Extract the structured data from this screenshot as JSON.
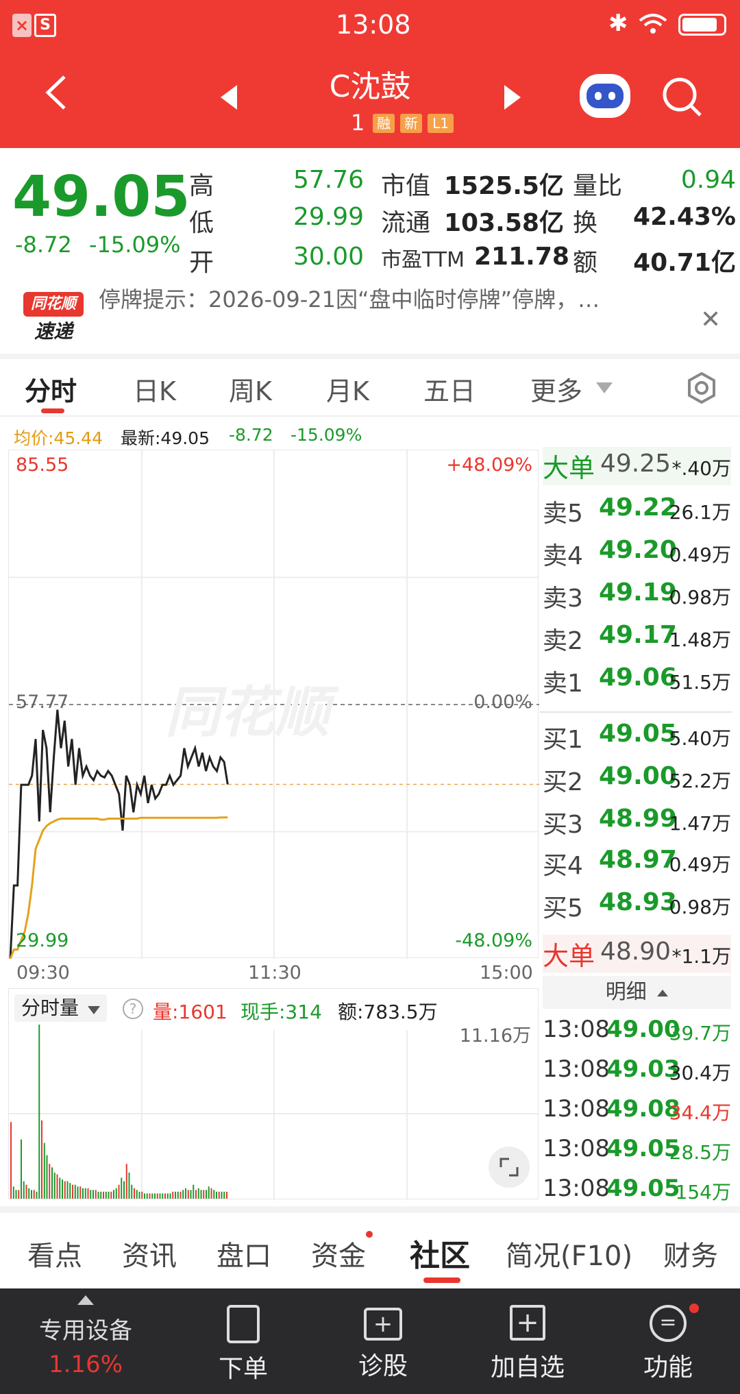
{
  "status": {
    "time": "13:08",
    "left_icons": [
      "close-badge-icon",
      "s-badge-icon"
    ],
    "right_icons": [
      "bluetooth-icon",
      "wifi-icon",
      "battery-icon"
    ]
  },
  "header": {
    "title": "C沈鼓",
    "code_suffix": "1",
    "badges": [
      "融",
      "新",
      "L1"
    ]
  },
  "quote": {
    "price": "49.05",
    "change": "-8.72",
    "pct": "-15.09%",
    "grid": [
      {
        "label": "高",
        "value": "57.76"
      },
      {
        "label": "低",
        "value": "29.99"
      },
      {
        "label": "开",
        "value": "30.00"
      },
      {
        "label": "市值",
        "value": "1525.5亿"
      },
      {
        "label": "流通",
        "value": "103.58亿"
      },
      {
        "label": "市盈TTM",
        "value": "211.78"
      },
      {
        "label": "量比",
        "value": "0.94"
      },
      {
        "label": "换",
        "value": "42.43%"
      },
      {
        "label": "额",
        "value": "40.71亿"
      }
    ]
  },
  "notice": {
    "brand_top": "同花顺",
    "brand_bottom": "速递",
    "text": "停牌提示：2026-09-21因“盘中临时停牌”停牌，…"
  },
  "tabs": [
    "分时",
    "日K",
    "周K",
    "月K",
    "五日",
    "更多"
  ],
  "info": {
    "avg": "均价:45.44",
    "latest": "最新:49.05",
    "change": "-8.72",
    "pct": "-15.09%"
  },
  "chart_data": {
    "type": "line",
    "y_top": "85.55",
    "y_mid": "57.77",
    "y_bottom": "29.99",
    "pct_top": "+48.09%",
    "pct_mid": "0.00%",
    "pct_bottom": "-48.09%",
    "x_labels": [
      "09:30",
      "11:30",
      "15:00"
    ],
    "ylim": [
      29.99,
      85.55
    ],
    "series": [
      {
        "name": "price",
        "values": [
          29.99,
          38,
          38,
          49,
          49,
          49,
          50,
          54,
          45,
          55,
          53,
          46,
          52,
          57.2,
          53,
          56,
          51,
          54,
          49,
          53,
          50,
          51,
          50,
          49.5,
          50.5,
          50,
          49.8,
          50.5,
          50,
          49,
          48,
          44,
          50,
          49,
          46,
          49,
          48,
          50,
          47,
          49,
          47.5,
          48,
          49,
          49,
          50,
          49,
          49.5,
          50,
          53,
          51,
          52,
          53,
          51,
          52.5,
          50.5,
          52,
          51,
          50.5,
          52,
          51.5,
          49.05
        ]
      },
      {
        "name": "avg",
        "values": [
          29.99,
          31,
          31,
          32,
          33,
          35,
          38,
          42,
          43,
          44,
          44.5,
          44.8,
          45,
          45.2,
          45.3,
          45.3,
          45.3,
          45.3,
          45.3,
          45.3,
          45.3,
          45.3,
          45.3,
          45.3,
          45.3,
          45.2,
          45.2,
          45.3,
          45.3,
          45.3,
          45.3,
          45.3,
          45.3,
          45.3,
          45.3,
          45.3,
          45.4,
          45.4,
          45.4,
          45.4,
          45.4,
          45.4,
          45.4,
          45.4,
          45.4,
          45.4,
          45.4,
          45.4,
          45.4,
          45.4,
          45.4,
          45.4,
          45.4,
          45.4,
          45.4,
          45.4,
          45.4,
          45.4,
          45.44,
          45.44,
          45.44
        ]
      }
    ]
  },
  "volume": {
    "selector": "分时量",
    "amount": "量:1601",
    "hand": "现手:314",
    "value": "额:783.5万",
    "max": "11.16万",
    "bars": [
      0.44,
      0.07,
      0.05,
      0.05,
      0.34,
      0.1,
      0.08,
      0.06,
      0.05,
      0.05,
      0.04,
      1.0,
      0.45,
      0.32,
      0.25,
      0.2,
      0.18,
      0.15,
      0.14,
      0.12,
      0.11,
      0.1,
      0.1,
      0.09,
      0.08,
      0.08,
      0.07,
      0.07,
      0.06,
      0.06,
      0.06,
      0.05,
      0.05,
      0.05,
      0.04,
      0.04,
      0.04,
      0.04,
      0.04,
      0.04,
      0.05,
      0.06,
      0.08,
      0.12,
      0.1,
      0.2,
      0.15,
      0.08,
      0.06,
      0.05,
      0.04,
      0.04,
      0.03,
      0.03,
      0.03,
      0.03,
      0.03,
      0.03,
      0.03,
      0.03,
      0.03,
      0.03,
      0.03,
      0.04,
      0.04,
      0.04,
      0.04,
      0.05,
      0.06,
      0.05,
      0.05,
      0.08,
      0.05,
      0.06,
      0.05,
      0.05,
      0.05,
      0.07,
      0.06,
      0.05,
      0.04,
      0.04,
      0.04,
      0.04,
      0.04
    ]
  },
  "book": {
    "big_sell": {
      "label": "大单",
      "price": "49.25",
      "vol": "*.40万"
    },
    "asks": [
      {
        "label": "卖5",
        "price": "49.22",
        "vol": "26.1万"
      },
      {
        "label": "卖4",
        "price": "49.20",
        "vol": "0.49万"
      },
      {
        "label": "卖3",
        "price": "49.19",
        "vol": "0.98万"
      },
      {
        "label": "卖2",
        "price": "49.17",
        "vol": "1.48万"
      },
      {
        "label": "卖1",
        "price": "49.06",
        "vol": "51.5万"
      }
    ],
    "bids": [
      {
        "label": "买1",
        "price": "49.05",
        "vol": "5.40万"
      },
      {
        "label": "买2",
        "price": "49.00",
        "vol": "52.2万"
      },
      {
        "label": "买3",
        "price": "48.99",
        "vol": "1.47万"
      },
      {
        "label": "买4",
        "price": "48.97",
        "vol": "0.49万"
      },
      {
        "label": "买5",
        "price": "48.93",
        "vol": "0.98万"
      }
    ],
    "big_buy": {
      "label": "大单",
      "price": "48.90",
      "vol": "*1.1万"
    },
    "detail_label": "明细",
    "trades": [
      {
        "time": "13:08",
        "price": "49.00",
        "vol": "39.7万",
        "vol_color": "#1a9a2a"
      },
      {
        "time": "13:08",
        "price": "49.03",
        "vol": "30.4万",
        "vol_color": "#222"
      },
      {
        "time": "13:08",
        "price": "49.08",
        "vol": "34.4万",
        "vol_color": "#e8372e"
      },
      {
        "time": "13:08",
        "price": "49.05",
        "vol": "28.5万",
        "vol_color": "#1a9a2a"
      },
      {
        "time": "13:08",
        "price": "49.05",
        "vol": "154万",
        "vol_color": "#1a9a2a"
      }
    ]
  },
  "bottom_tabs": [
    "看点",
    "资讯",
    "盘口",
    "资金",
    "社区",
    "简况(F10)",
    "财务"
  ],
  "nav": {
    "device": "专用设备",
    "device_pct": "1.16%",
    "items": [
      "下单",
      "诊股",
      "加自选",
      "功能"
    ]
  }
}
